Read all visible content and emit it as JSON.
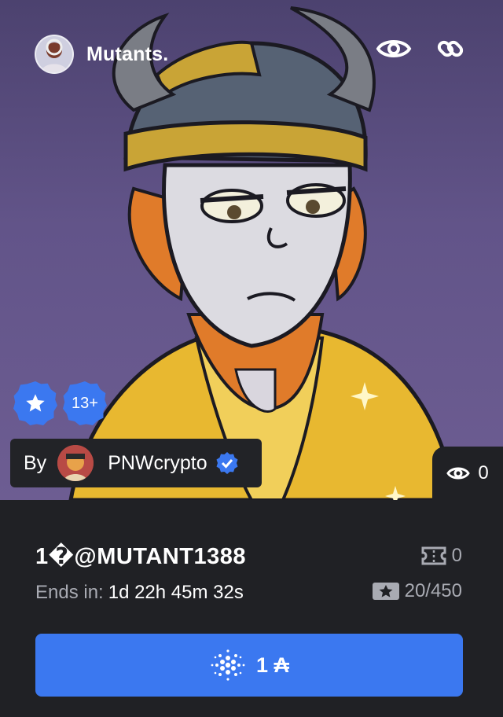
{
  "collection": {
    "name": "Mutants."
  },
  "badges": {
    "age": "13+"
  },
  "creator": {
    "by_label": "By",
    "name": "PNWcrypto"
  },
  "views": {
    "count": "0"
  },
  "listing": {
    "title": "1�@MUTANT1388",
    "ends_label": "Ends in:",
    "ends_value": "1d 22h 45m 32s",
    "tickets": "0",
    "editions": "20/450"
  },
  "buy": {
    "price": "1 ₳"
  },
  "colors": {
    "accent": "#3b78f0",
    "background": "#202125",
    "muted": "#a9abb3"
  },
  "icons": [
    "eye-icon",
    "link-icon",
    "star-icon",
    "verified-icon",
    "ticket-icon",
    "edition-icon",
    "cardano-icon"
  ]
}
